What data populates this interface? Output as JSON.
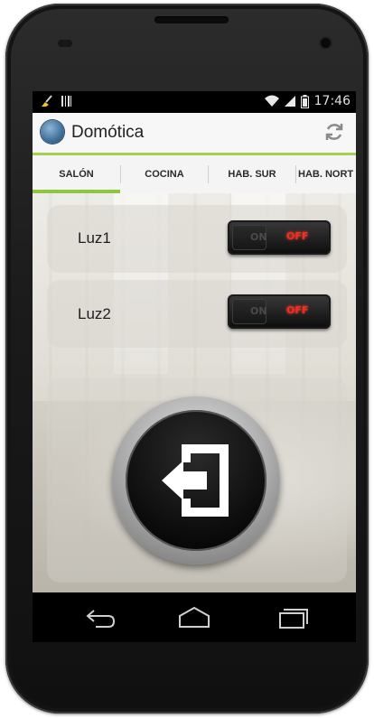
{
  "statusbar": {
    "time": "17:46"
  },
  "app": {
    "title": "Domótica"
  },
  "tabs": [
    {
      "label": "SALÓN",
      "selected": true
    },
    {
      "label": "COCINA",
      "selected": false
    },
    {
      "label": "HAB. SUR",
      "selected": false
    },
    {
      "label": "HAB. NORT",
      "selected": false
    }
  ],
  "lights": [
    {
      "label": "Luz1",
      "on_label": "ON",
      "off_label": "OFF",
      "state": "off"
    },
    {
      "label": "Luz2",
      "on_label": "ON",
      "off_label": "OFF",
      "state": "off"
    }
  ],
  "colors": {
    "accent": "#8ec63f",
    "off_red": "#ff2a1a"
  },
  "icons": {
    "refresh": "refresh-icon",
    "exit": "exit-icon",
    "back": "back-icon",
    "home": "home-icon",
    "recents": "recent-apps-icon"
  }
}
